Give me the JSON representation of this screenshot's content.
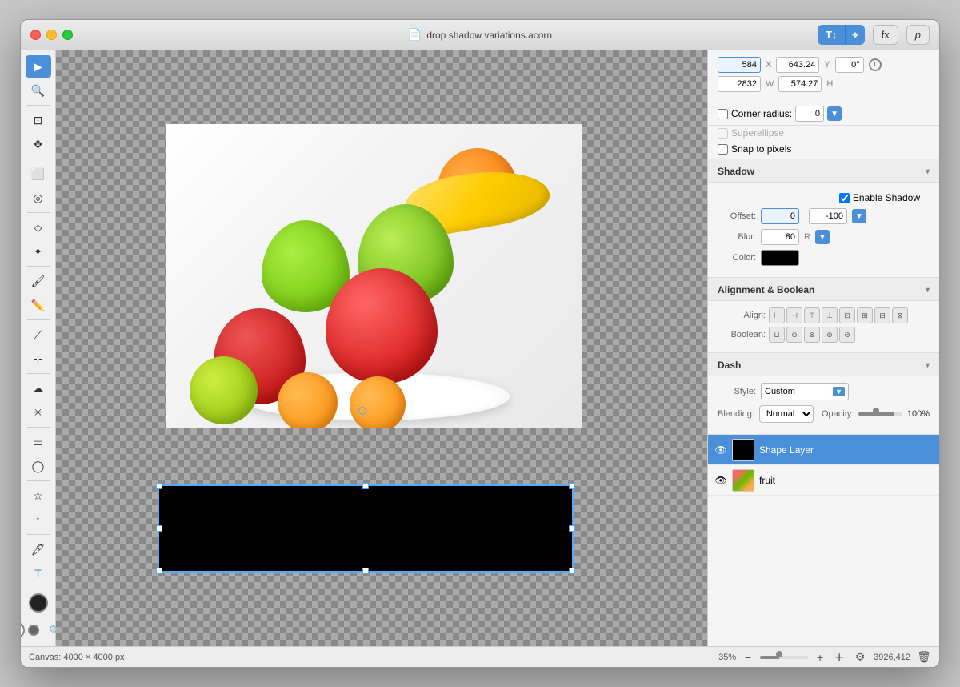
{
  "window": {
    "title": "drop shadow variations.acorn",
    "close_label": "×",
    "min_label": "−",
    "max_label": "+"
  },
  "toolbar": {
    "type_btn": "T↕",
    "fx_btn": "fx",
    "p_btn": "p"
  },
  "coords": {
    "x_val": "584",
    "x_label": "X",
    "y_val": "643.24",
    "y_label": "Y",
    "angle_val": "0°",
    "w_val": "2832",
    "w_label": "W",
    "h_val": "574.27",
    "h_label": "H"
  },
  "corner_radius": {
    "label": "Corner radius:",
    "value": "0",
    "checkbox_checked": false
  },
  "superellipse": {
    "label": "Superellipse",
    "disabled": true
  },
  "snap": {
    "label": "Snap to pixels"
  },
  "shadow": {
    "title": "Shadow",
    "enable_label": "Enable Shadow",
    "enabled": true,
    "offset_label": "Offset:",
    "offset_x": "0",
    "offset_y": "-100",
    "blur_label": "Blur:",
    "blur_val": "80",
    "blur_suffix": "R",
    "color_label": "Color:"
  },
  "alignment": {
    "title": "Alignment & Boolean",
    "align_label": "Align:",
    "boolean_label": "Boolean:",
    "align_icons": [
      "⊞",
      "⊟",
      "⊠",
      "⊡",
      "⊢",
      "⊣",
      "⊤",
      "⊥"
    ],
    "boolean_icons": [
      "□",
      "■",
      "▣",
      "▤",
      "▥"
    ]
  },
  "dash": {
    "title": "Dash",
    "style_label": "Style:",
    "style_value": "Custom",
    "blending_label": "Blending:",
    "blend_value": "Normal",
    "opacity_label": "Opacity:",
    "opacity_value": "100%"
  },
  "layers": [
    {
      "name": "Shape Layer",
      "visible": true,
      "selected": true,
      "type": "black"
    },
    {
      "name": "fruit",
      "visible": true,
      "selected": false,
      "type": "fruit"
    }
  ],
  "statusbar": {
    "canvas_info": "Canvas: 4000 × 4000 px",
    "zoom": "35%",
    "pixel_count": "3926,412"
  }
}
